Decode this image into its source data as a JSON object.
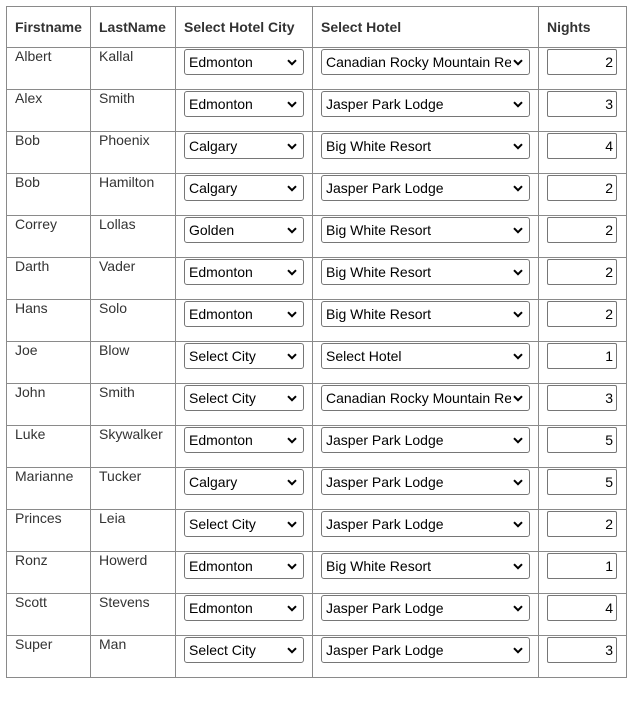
{
  "headers": {
    "firstname": "Firstname",
    "lastname": "LastName",
    "city": "Select Hotel City",
    "hotel": "Select Hotel",
    "nights": "Nights"
  },
  "rows": [
    {
      "first": "Albert",
      "last": "Kallal",
      "city": "Edmonton",
      "hotel": "Canadian Rocky Mountain Re",
      "nights": "2"
    },
    {
      "first": "Alex",
      "last": "Smith",
      "city": "Edmonton",
      "hotel": "Jasper Park Lodge",
      "nights": "3"
    },
    {
      "first": "Bob",
      "last": "Phoenix",
      "city": "Calgary",
      "hotel": "Big White Resort",
      "nights": "4"
    },
    {
      "first": "Bob",
      "last": "Hamilton",
      "city": "Calgary",
      "hotel": "Jasper Park Lodge",
      "nights": "2"
    },
    {
      "first": "Correy",
      "last": "Lollas",
      "city": "Golden",
      "hotel": "Big White Resort",
      "nights": "2"
    },
    {
      "first": "Darth",
      "last": "Vader",
      "city": "Edmonton",
      "hotel": "Big White Resort",
      "nights": "2"
    },
    {
      "first": "Hans",
      "last": "Solo",
      "city": "Edmonton",
      "hotel": "Big White Resort",
      "nights": "2"
    },
    {
      "first": "Joe",
      "last": "Blow",
      "city": "Select City",
      "hotel": "Select Hotel",
      "nights": "1"
    },
    {
      "first": "John",
      "last": "Smith",
      "city": "Select City",
      "hotel": "Canadian Rocky Mountain Re",
      "nights": "3"
    },
    {
      "first": "Luke",
      "last": "Skywalker",
      "city": "Edmonton",
      "hotel": "Jasper Park Lodge",
      "nights": "5"
    },
    {
      "first": "Marianne",
      "last": "Tucker",
      "city": "Calgary",
      "hotel": "Jasper Park Lodge",
      "nights": "5"
    },
    {
      "first": "Princes",
      "last": "Leia",
      "city": "Select City",
      "hotel": "Jasper Park Lodge",
      "nights": "2"
    },
    {
      "first": "Ronz",
      "last": "Howerd",
      "city": "Edmonton",
      "hotel": "Big White Resort",
      "nights": "1"
    },
    {
      "first": "Scott",
      "last": "Stevens",
      "city": "Edmonton",
      "hotel": "Jasper Park Lodge",
      "nights": "4"
    },
    {
      "first": "Super",
      "last": "Man",
      "city": "Select City",
      "hotel": "Jasper Park Lodge",
      "nights": "3"
    }
  ],
  "icons": {
    "dropdown": "chevron-down-icon"
  }
}
